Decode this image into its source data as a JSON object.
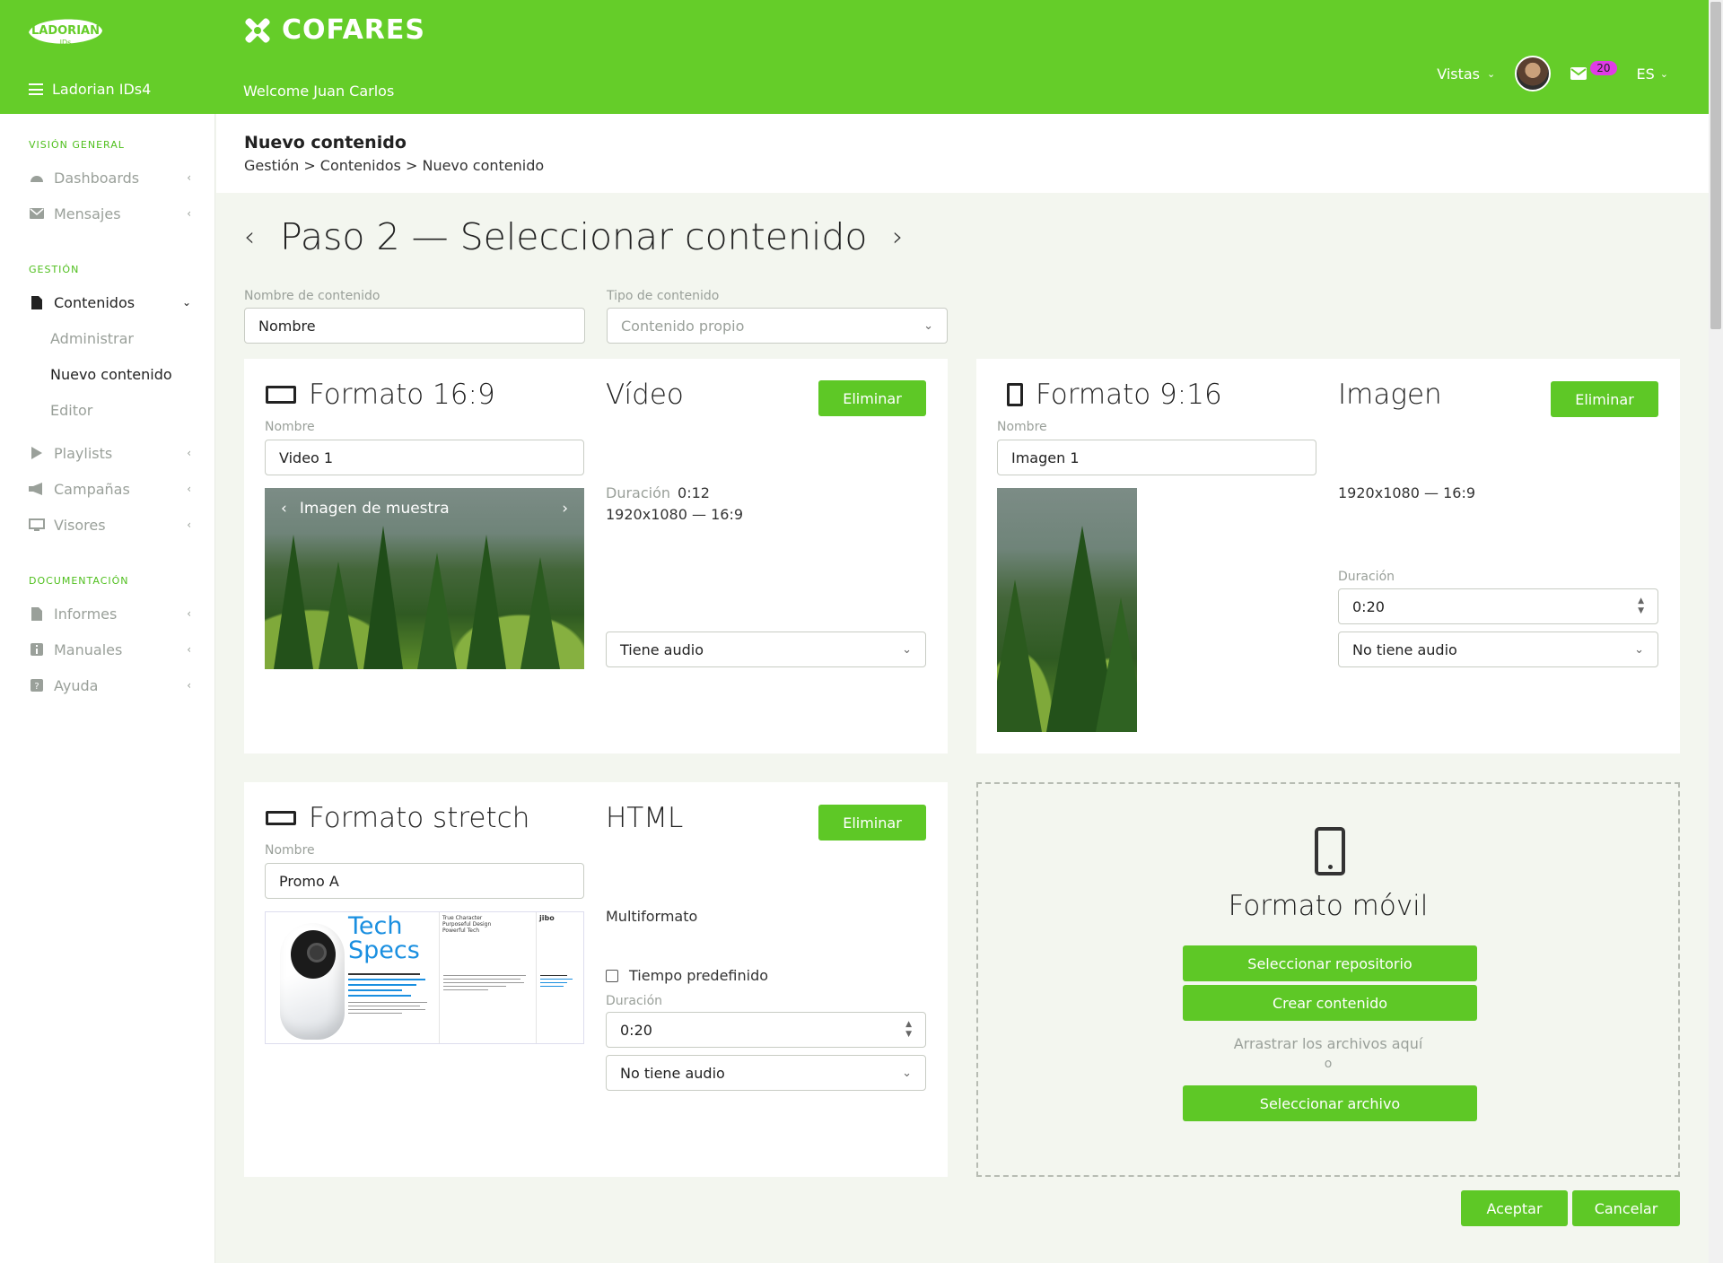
{
  "header": {
    "brand": "LADORIAN",
    "brand_sub": "IDs",
    "app_name": "Ladorian IDs4",
    "client": "COFARES",
    "welcome": "Welcome Juan Carlos",
    "vistas": "Vistas",
    "mail_count": "20",
    "lang": "ES"
  },
  "sidebar": {
    "section_overview": "VISIÓN GENERAL",
    "dashboards": "Dashboards",
    "mensajes": "Mensajes",
    "section_gestion": "GESTIÓN",
    "contenidos": "Contenidos",
    "administrar": "Administrar",
    "nuevo": "Nuevo contenido",
    "editor": "Editor",
    "playlists": "Playlists",
    "campanas": "Campañas",
    "visores": "Visores",
    "section_doc": "DOCUMENTACIÓN",
    "informes": "Informes",
    "manuales": "Manuales",
    "ayuda": "Ayuda"
  },
  "page": {
    "title": "Nuevo contenido",
    "breadcrumb": "Gestión > Contenidos > Nuevo contenido",
    "step_title": "Paso 2 — Seleccionar contenido",
    "name_label": "Nombre de contenido",
    "name_value": "Nombre",
    "type_label": "Tipo de contenido",
    "type_placeholder": "Contenido propio"
  },
  "card_169": {
    "title": "Formato 16:9",
    "type": "Vídeo",
    "delete": "Eliminar",
    "name_label": "Nombre",
    "name_value": "Video 1",
    "image_caption": "Imagen de muestra",
    "duration_key": "Duración",
    "duration_value": "0:12",
    "resolution": "1920x1080 — 16:9",
    "audio": "Tiene audio"
  },
  "card_916": {
    "title": "Formato 9:16",
    "type": "Imagen",
    "delete": "Eliminar",
    "name_label": "Nombre",
    "name_value": "Imagen 1",
    "resolution": "1920x1080 — 16:9",
    "duration_label": "Duración",
    "duration_value": "0:20",
    "audio": "No tiene audio"
  },
  "card_stretch": {
    "title": "Formato stretch",
    "type": "HTML",
    "delete": "Eliminar",
    "name_label": "Nombre",
    "name_value": "Promo A",
    "ts_title_1": "Tech",
    "ts_title_2": "Specs",
    "ts_col2_head": "True Character\nPurposeful Design\nPowerful Tech",
    "ts_col3_head": "jibo",
    "multiformat": "Multiformato",
    "default_time": "Tiempo predefinido",
    "duration_label": "Duración",
    "duration_value": "0:20",
    "audio": "No tiene audio"
  },
  "card_mobile": {
    "title": "Formato móvil",
    "select_repo": "Seleccionar repositorio",
    "create": "Crear contenido",
    "drag": "Arrastrar los archivos aquí",
    "or": "o",
    "select_file": "Seleccionar archivo"
  },
  "footer": {
    "accept": "Aceptar",
    "cancel": "Cancelar"
  },
  "colors": {
    "brand_green": "#65cd29",
    "button_green": "#5ec826",
    "badge_magenta": "#e03be6"
  }
}
